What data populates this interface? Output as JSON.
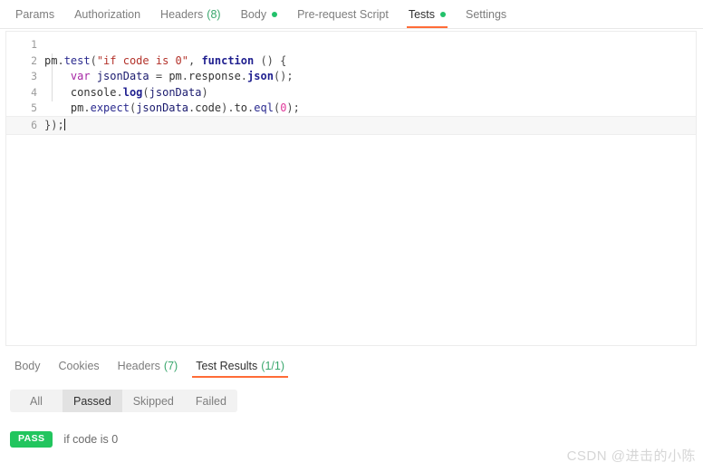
{
  "request_tabs": [
    {
      "label": "Params",
      "count": "",
      "dot": false,
      "active": false
    },
    {
      "label": "Authorization",
      "count": "",
      "dot": false,
      "active": false
    },
    {
      "label": "Headers",
      "count": "(8)",
      "dot": false,
      "active": false
    },
    {
      "label": "Body",
      "count": "",
      "dot": true,
      "active": false
    },
    {
      "label": "Pre-request Script",
      "count": "",
      "dot": false,
      "active": false
    },
    {
      "label": "Tests",
      "count": "",
      "dot": true,
      "active": true
    },
    {
      "label": "Settings",
      "count": "",
      "dot": false,
      "active": false
    }
  ],
  "editor": {
    "lines": [
      {
        "num": "1",
        "text": "",
        "active": false
      },
      {
        "num": "2",
        "text": "pm.test(\"if code is 0\", function () {",
        "active": false
      },
      {
        "num": "3",
        "text": "    var jsonData = pm.response.json();",
        "active": false
      },
      {
        "num": "4",
        "text": "    console.log(jsonData)",
        "active": false
      },
      {
        "num": "5",
        "text": "    pm.expect(jsonData.code).to.eql(0);",
        "active": false
      },
      {
        "num": "6",
        "text": "});",
        "active": true
      }
    ]
  },
  "response_tabs": [
    {
      "label": "Body",
      "count": "",
      "active": false
    },
    {
      "label": "Cookies",
      "count": "",
      "active": false
    },
    {
      "label": "Headers",
      "count": "(7)",
      "active": false
    },
    {
      "label": "Test Results",
      "count": "(1/1)",
      "active": true
    }
  ],
  "filters": [
    {
      "label": "All",
      "active": false
    },
    {
      "label": "Passed",
      "active": true
    },
    {
      "label": "Skipped",
      "active": false
    },
    {
      "label": "Failed",
      "active": false
    }
  ],
  "results": [
    {
      "status": "PASS",
      "name": "if code is 0"
    }
  ],
  "watermark": "CSDN @进击的小陈",
  "colors": {
    "accent": "#ff6c37",
    "pass_green": "#22c55e",
    "count_green": "#3aa76d",
    "dot_green": "#23c16b"
  }
}
